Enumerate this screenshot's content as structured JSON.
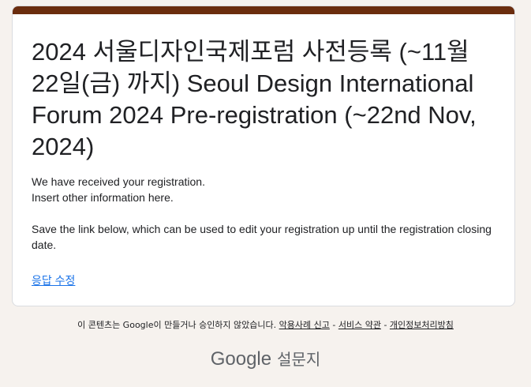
{
  "form": {
    "title": "2024 서울디자인국제포럼 사전등록 (~11월 22일(금) 까지) Seoul Design International Forum 2024 Pre-registration (~22nd Nov, 2024)",
    "message_line1": "We have received your registration.",
    "message_line2": "Insert other information here.",
    "message_line3": "Save the link below, which can be used to edit your registration up until the registration closing date.",
    "edit_response_label": "응답 수정"
  },
  "footer": {
    "disclaimer": "이 콘텐츠는 Google이 만들거나 승인하지 않았습니다.",
    "report_abuse": "악용사례 신고",
    "separator": " - ",
    "terms": "서비스 약관",
    "privacy": "개인정보처리방침"
  },
  "branding": {
    "google": "Google",
    "product": "설문지"
  },
  "colors": {
    "accent": "#6b2d0e",
    "background": "#f6f2ee",
    "link": "#1a73e8"
  }
}
